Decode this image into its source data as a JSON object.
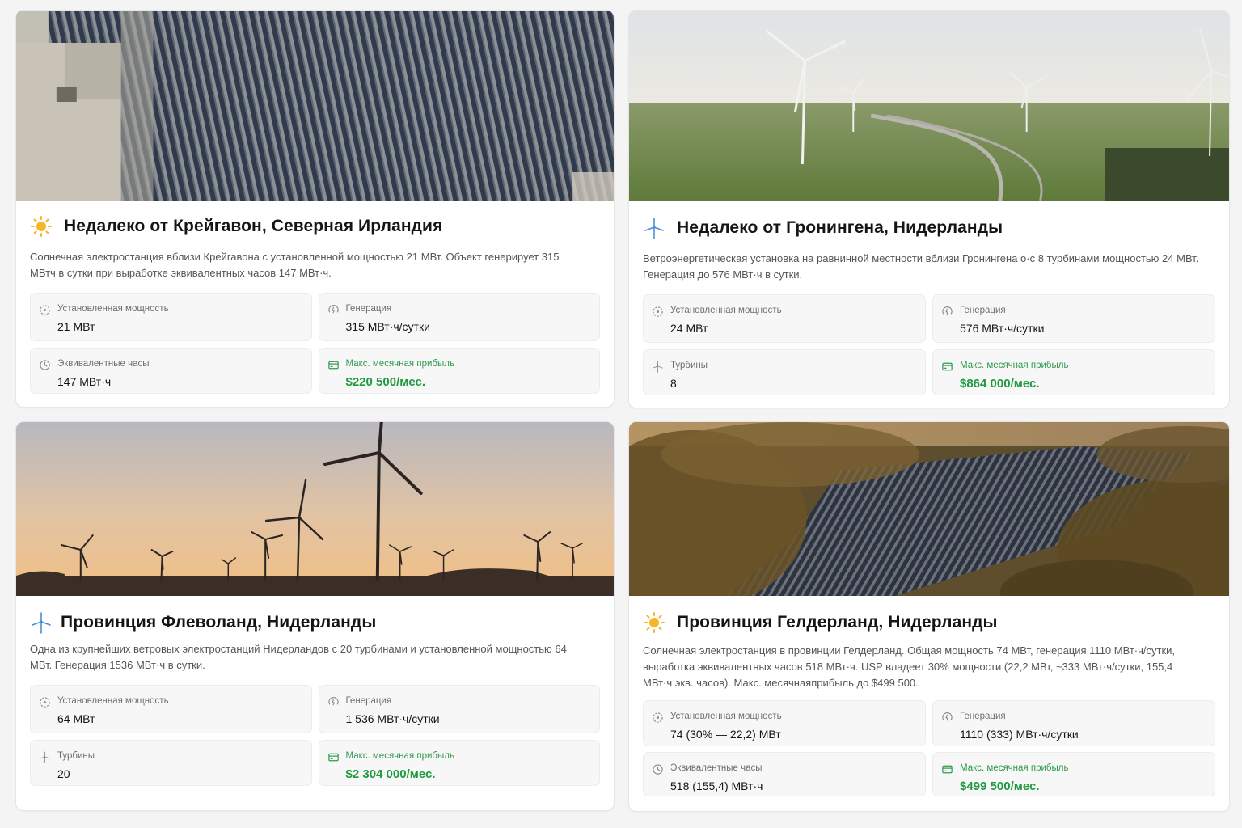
{
  "colors": {
    "accent_green": "#1f9a3f",
    "sun": "#f5a623",
    "turbine": "#4a90d9"
  },
  "cards": [
    {
      "icon": "sun-icon",
      "title": "Недалеко от Крейгавон, Северная Ирландия",
      "description": "Солнечная электростанция вблизи Крейгавона с установленной мощностью 21 МВт. Объект генерирует 315 МВтч в сутки при выработке эквивалентных часов 147 МВт·ч.",
      "stats": [
        {
          "icon": "capacity-icon",
          "label": "Установленная мощность",
          "value": "21 МВт"
        },
        {
          "icon": "generation-icon",
          "label": "Генерация",
          "value": "315 МВт·ч/сутки"
        },
        {
          "icon": "clock-icon",
          "label": "Эквивалентные часы",
          "value": "147 МВт·ч"
        },
        {
          "icon": "wallet-icon",
          "label": "Макс. месячная прибыль",
          "value": "$220 500/мес."
        }
      ]
    },
    {
      "icon": "wind-turbine-icon",
      "title": "Недалеко от Гронингена, Нидерланды",
      "description": "Ветроэнергетическая установка на равнинной местности вблизи Гронингена о·с 8 турбинами мощностью 24 МВт. Генерация до 576 МВт·ч в сутки.",
      "stats": [
        {
          "icon": "capacity-icon",
          "label": "Установленная мощность",
          "value": "24 МВт"
        },
        {
          "icon": "generation-icon",
          "label": "Генерация",
          "value": "576 МВт·ч/сутки"
        },
        {
          "icon": "wind-turbine-icon",
          "label": "Турбины",
          "value": "8"
        },
        {
          "icon": "wallet-icon",
          "label": "Макс. месячная прибыль",
          "value": "$864 000/мес."
        }
      ]
    },
    {
      "icon": "wind-turbine-icon",
      "title": "Провинция Флеволанд, Нидерланды",
      "description": "Одна из крупнейших ветровых электростанций Нидерландов с 20 турбинами и установленной мощностью 64 МВт. Генерация 1536 МВт·ч в сутки.",
      "stats": [
        {
          "icon": "capacity-icon",
          "label": "Установленная мощность",
          "value": "64 МВт"
        },
        {
          "icon": "generation-icon",
          "label": "Генерация",
          "value": "1 536 МВт·ч/сутки"
        },
        {
          "icon": "wind-turbine-icon",
          "label": "Турбины",
          "value": "20"
        },
        {
          "icon": "wallet-icon",
          "label": "Макс. месячная прибыль",
          "value": "$2 304 000/мес."
        }
      ]
    },
    {
      "icon": "sun-icon",
      "title": "Провинция Гелдерланд, Нидерланды",
      "description": "Солнечная электростанция в провинции Гелдерланд. Общая мощность 74 МВт, генерация 1110 МВт·ч/сутки, выработка эквивалентных часов 518 МВт·ч. USP владеет 30% мощности (22,2 МВт, ~333 МВт·ч/сутки, 155,4 МВт·ч экв. часов). Макс. месячнаяприбыль до $499 500.",
      "stats": [
        {
          "icon": "capacity-icon",
          "label": "Установленная мощность",
          "value": "74 (30% — 22,2) МВт"
        },
        {
          "icon": "generation-icon",
          "label": "Генерация",
          "value": "1110 (333) МВт·ч/сутки"
        },
        {
          "icon": "clock-icon",
          "label": "Эквивалентные часы",
          "value": "518 (155,4) МВт·ч"
        },
        {
          "icon": "wallet-icon",
          "label": "Макс. месячная прибыль",
          "value": "$499 500/мес."
        }
      ]
    }
  ]
}
